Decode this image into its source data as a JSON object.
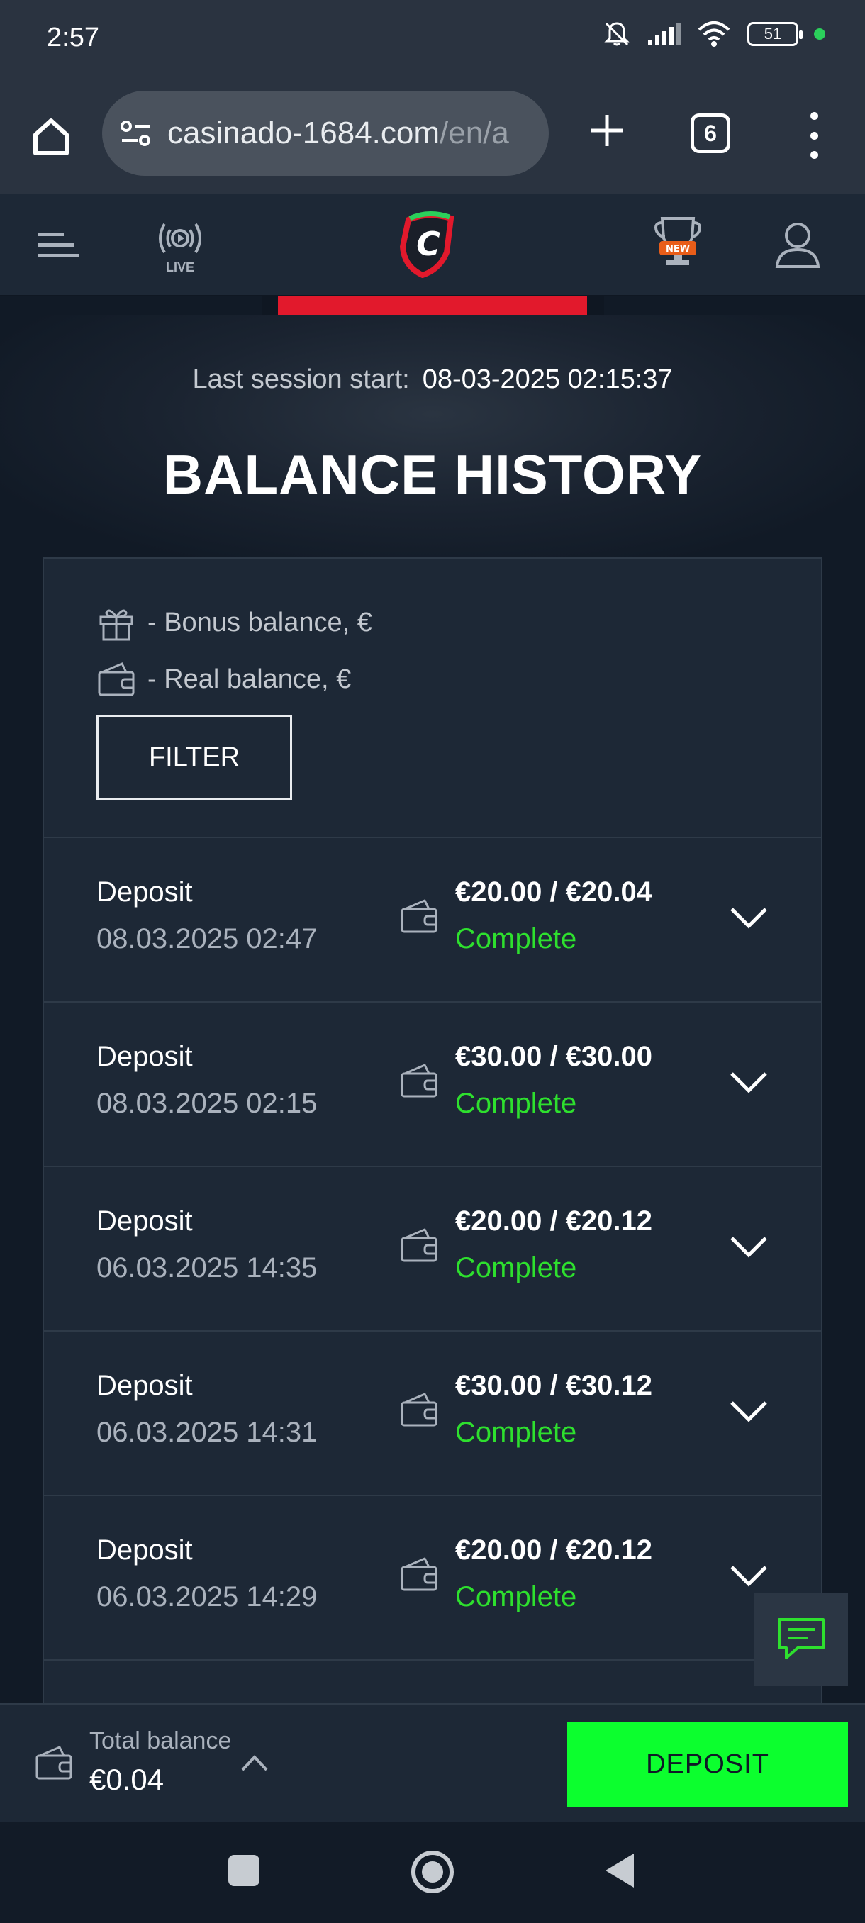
{
  "status_bar": {
    "time": "2:57",
    "battery": "51",
    "icons": [
      "bell-off-icon",
      "signal-icon",
      "wifi-icon",
      "battery-icon",
      "notification-dot"
    ]
  },
  "browser": {
    "url_main": "casinado-1684.com",
    "url_dim": "/en/a",
    "tab_count": "6"
  },
  "site_header": {
    "live_label": "LIVE",
    "trophy_badge": "NEW",
    "logo_letter": "C"
  },
  "hero": {
    "session_label": "Last session start:",
    "session_value": "08-03-2025 02:15:37",
    "title": "BALANCE HISTORY"
  },
  "legend": {
    "bonus": "- Bonus balance, €",
    "real": "- Real balance, €"
  },
  "filter_label": "FILTER",
  "transactions": [
    {
      "type": "Deposit",
      "date": "08.03.2025 02:47",
      "amount": "€20.00 / €20.04",
      "status": "Complete"
    },
    {
      "type": "Deposit",
      "date": "08.03.2025 02:15",
      "amount": "€30.00 / €30.00",
      "status": "Complete"
    },
    {
      "type": "Deposit",
      "date": "06.03.2025 14:35",
      "amount": "€20.00 / €20.12",
      "status": "Complete"
    },
    {
      "type": "Deposit",
      "date": "06.03.2025 14:31",
      "amount": "€30.00 / €30.12",
      "status": "Complete"
    },
    {
      "type": "Deposit",
      "date": "06.03.2025 14:29",
      "amount": "€20.00 / €20.12",
      "status": "Complete"
    }
  ],
  "balance_bar": {
    "label": "Total balance",
    "value": "€0.04",
    "deposit_label": "DEPOSIT"
  },
  "colors": {
    "accent_red": "#e2192c",
    "complete_green": "#2ee02e",
    "deposit_green": "#0cff2e",
    "panel_bg": "#1d2836"
  }
}
